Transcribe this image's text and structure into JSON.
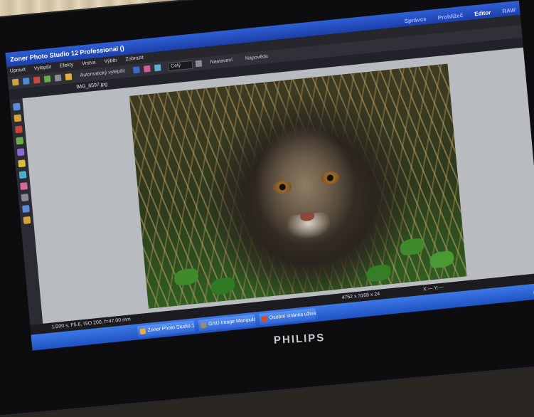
{
  "app": {
    "title": "Zoner Photo Studio 12 Professional  ()",
    "modes": [
      "Správce",
      "Prohlížeč",
      "Editor",
      "RAW"
    ],
    "active_mode": "Editor"
  },
  "menu": [
    "Upravit",
    "Vylepšit",
    "Efekty",
    "Vrstva",
    "Výběr",
    "Zobrazit"
  ],
  "toolbar": {
    "auto_enhance_label": "Automatický vylepšit",
    "zoom_select": "Celý",
    "help_items": [
      "Nastavení",
      "Nápověda"
    ]
  },
  "document": {
    "tab_label": "IMG_6597.jpg"
  },
  "status": {
    "exif": "1/200 s, F5.6, ISO 200, f=47.00 mm",
    "dimensions": "4752 x 3168 x 24",
    "coords": "X:--- Y:---"
  },
  "taskbar": {
    "items": [
      "Zoner Photo Studio 1...",
      "GNU Image Manipulat...",
      "Osobní stránka uživat..."
    ]
  },
  "monitor": {
    "brand": "PHILIPS"
  },
  "colors": {
    "titlebar": "#1c3fa8",
    "taskbar": "#1f52c4",
    "canvas": "#b8bbc0"
  }
}
